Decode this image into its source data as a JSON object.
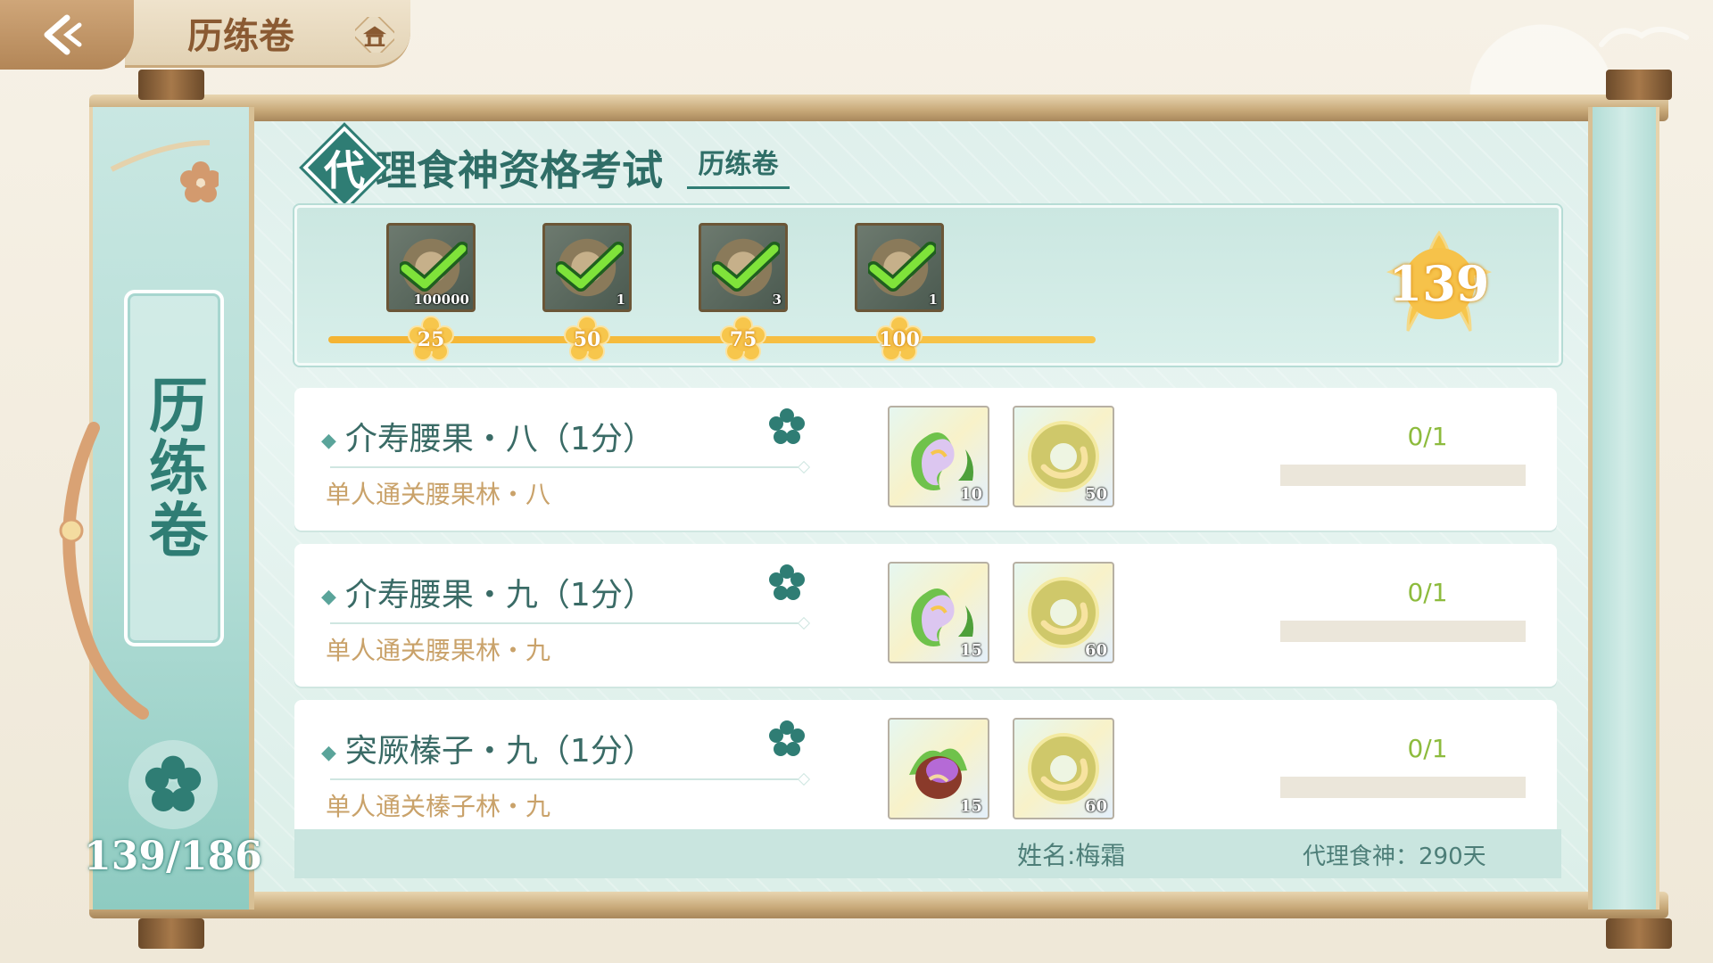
{
  "header": {
    "title": "历练卷"
  },
  "left_panel": {
    "label": "历练卷",
    "progress": "139/186"
  },
  "exam": {
    "title_first_char": "代",
    "title_rest": "理食神资格考试",
    "tab_label": "历练卷"
  },
  "milestones": {
    "total": "139",
    "track_progress": 1.0,
    "items": [
      {
        "threshold": "25",
        "qty": "100000",
        "claimed": true
      },
      {
        "threshold": "50",
        "qty": "1",
        "claimed": true
      },
      {
        "threshold": "75",
        "qty": "3",
        "claimed": true
      },
      {
        "threshold": "100",
        "qty": "1",
        "claimed": true
      }
    ]
  },
  "tasks": [
    {
      "title": "介寿腰果・八（1分）",
      "desc": "单人通关腰果林・八",
      "rewards": [
        {
          "icon": "cashew-fruit-icon",
          "qty": "10"
        },
        {
          "icon": "jade-coin-icon",
          "qty": "50"
        }
      ],
      "progress_text": "0/1",
      "progress": 0
    },
    {
      "title": "介寿腰果・九（1分）",
      "desc": "单人通关腰果林・九",
      "rewards": [
        {
          "icon": "cashew-fruit-icon",
          "qty": "15"
        },
        {
          "icon": "jade-coin-icon",
          "qty": "60"
        }
      ],
      "progress_text": "0/1",
      "progress": 0
    },
    {
      "title": "突厥榛子・九（1分）",
      "desc": "单人通关榛子林・九",
      "rewards": [
        {
          "icon": "hazelnut-fruit-icon",
          "qty": "15"
        },
        {
          "icon": "jade-coin-icon",
          "qty": "60"
        }
      ],
      "progress_text": "0/1",
      "progress": 0
    }
  ],
  "footer": {
    "name": "姓名:梅霜",
    "days": "代理食神：290天"
  },
  "colors": {
    "accent_teal": "#2f7d74",
    "gold": "#f4b433",
    "progress_green": "#8dbb3d",
    "desc_tan": "#c9a26a"
  }
}
